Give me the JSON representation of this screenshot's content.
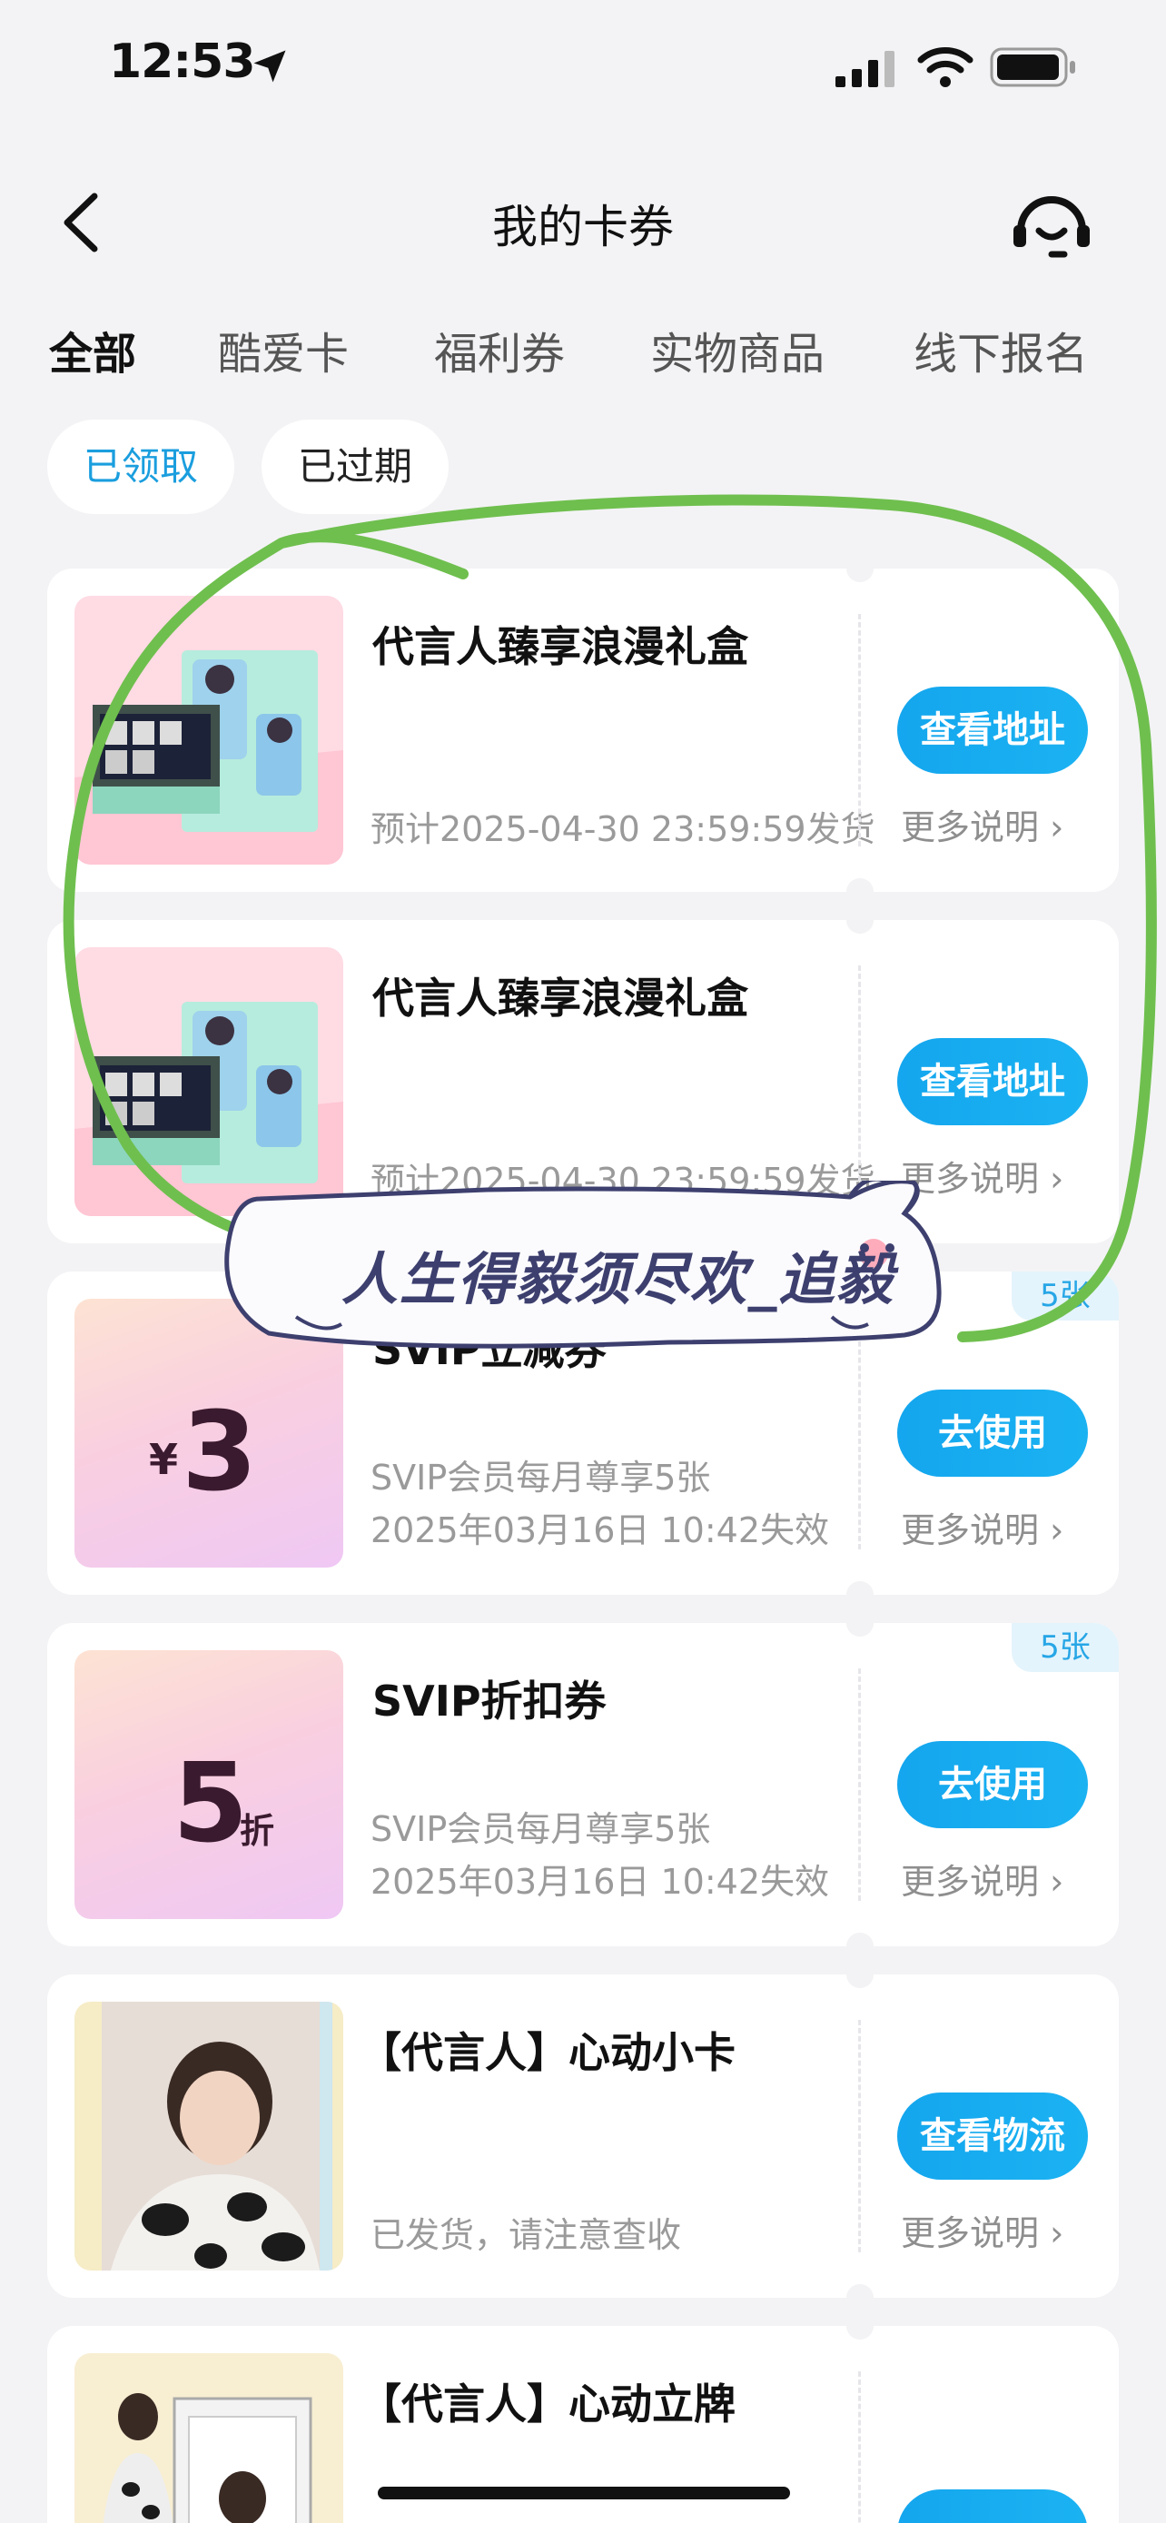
{
  "status": {
    "time": "12:53"
  },
  "nav": {
    "title": "我的卡券"
  },
  "tabs": [
    "全部",
    "酷爱卡",
    "福利券",
    "实物商品",
    "线下报名"
  ],
  "filters": [
    "已领取",
    "已过期"
  ],
  "cards": [
    {
      "title": "代言人臻享浪漫礼盒",
      "line1": "预计2025-04-30 23:59:59发货",
      "button": "查看地址",
      "more": "更多说明"
    },
    {
      "title": "代言人臻享浪漫礼盒",
      "line1": "预计2025-04-30 23:59:59发货",
      "button": "查看地址",
      "more": "更多说明"
    },
    {
      "title": "SVIP立减券",
      "line1": "SVIP会员每月尊享5张",
      "line2": "2025年03月16日 10:42失效",
      "button": "去使用",
      "more": "更多说明",
      "badge": "5张",
      "value": "3",
      "unit": "¥"
    },
    {
      "title": "SVIP折扣券",
      "line1": "SVIP会员每月尊享5张",
      "line2": "2025年03月16日 10:42失效",
      "button": "去使用",
      "more": "更多说明",
      "badge": "5张",
      "value": "5",
      "unit": "折"
    },
    {
      "title": "【代言人】心动小卡",
      "line1": "已发货，请注意查收",
      "button": "查看物流",
      "more": "更多说明"
    },
    {
      "title": "【代言人】心动立牌"
    }
  ],
  "sticker": {
    "text": "人生得毅须尽欢_追毅"
  },
  "colors": {
    "accent": "#1aa8ee",
    "scribble": "#6fbf4e"
  }
}
